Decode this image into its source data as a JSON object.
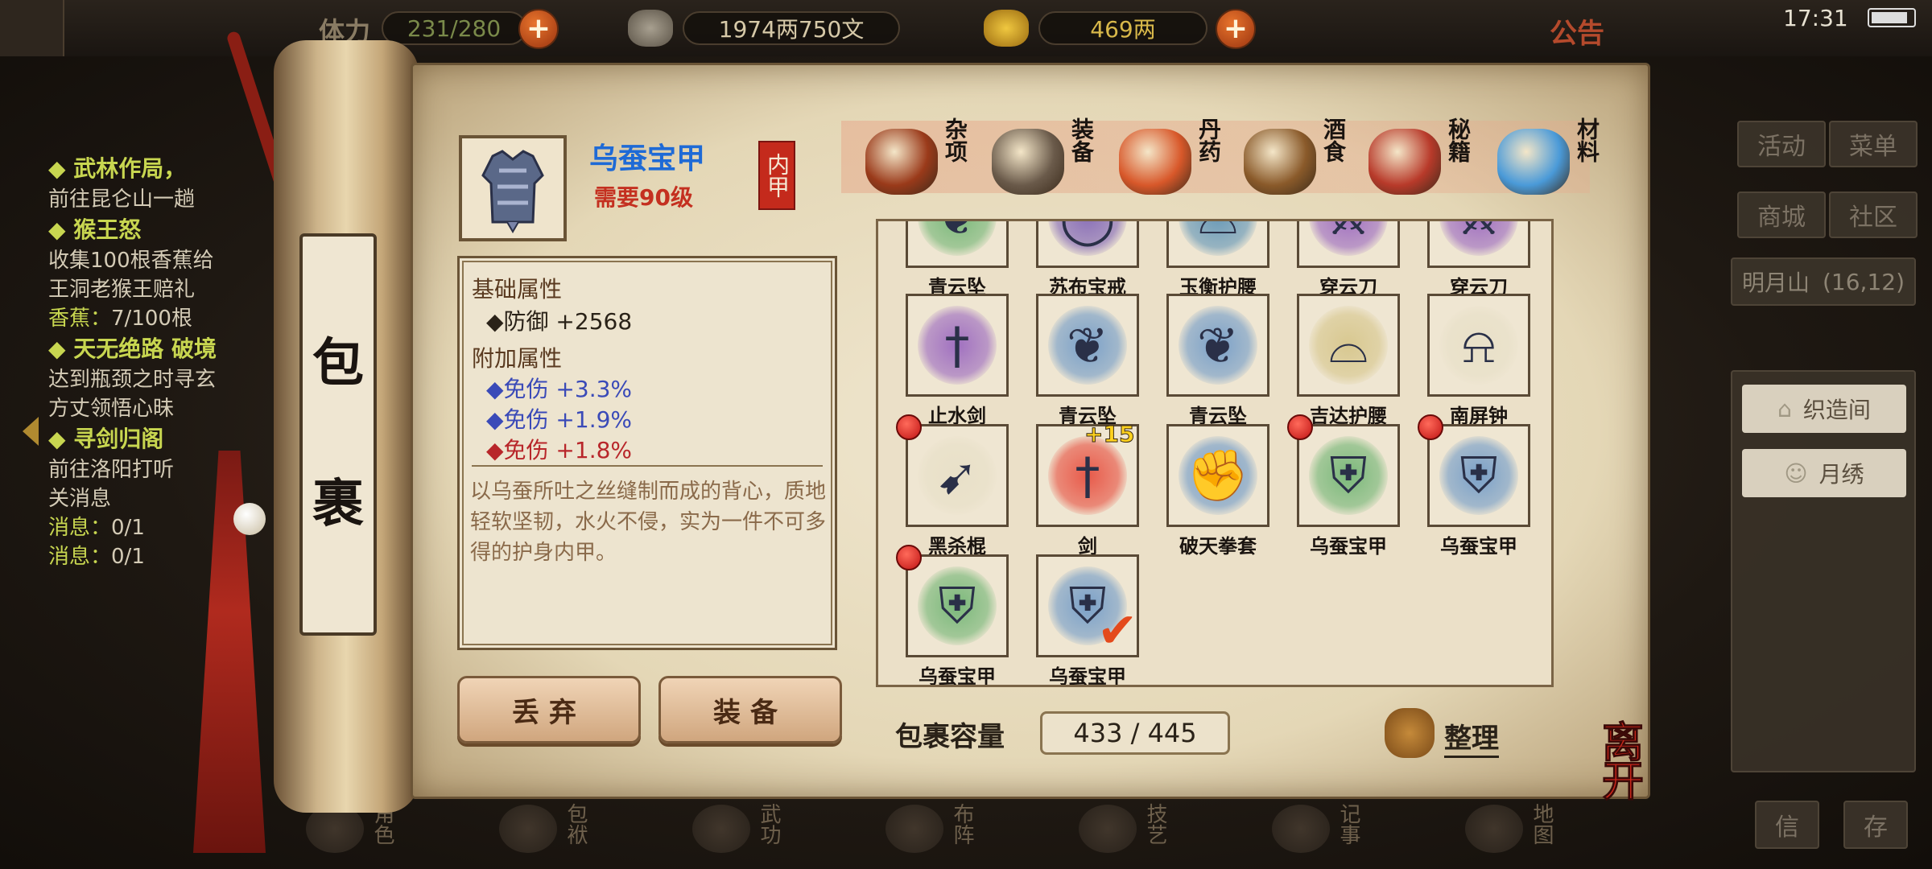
{
  "topbar": {
    "stamina_label": "体力",
    "stamina": "231/280",
    "money": "1974两750文",
    "gold": "469两",
    "notice": "公告",
    "time": "17:31"
  },
  "quests": [
    {
      "title": "◆ 武林作局，",
      "lines": [
        "前往昆仑山一趟"
      ]
    },
    {
      "title": "◆ 猴王怒",
      "lines": [
        "收集100根香蕉给",
        "王洞老猴王赔礼"
      ],
      "progress_label": "香蕉：",
      "progress": "7/100根"
    },
    {
      "title": "◆ 天无绝路 破境",
      "lines": [
        "达到瓶颈之时寻玄",
        "方丈领悟心昧"
      ]
    },
    {
      "title": "◆ 寻剑归阁",
      "lines": [
        "前往洛阳打听",
        "关消息"
      ],
      "progress_label": "消息：",
      "progress": "0/1",
      "progress2_label": "消息：",
      "progress2": "0/1"
    }
  ],
  "right_menu": {
    "buttons": [
      "活动",
      "菜单",
      "商城",
      "社区"
    ],
    "location": "明月山",
    "coords": "(16,12)",
    "side_items": [
      "织造间",
      "月绣"
    ],
    "bottom_buttons": [
      "信",
      "存"
    ]
  },
  "bottom_nav": [
    "角色",
    "包袱",
    "武功",
    "布阵",
    "技艺",
    "记事",
    "地图"
  ],
  "scroll": {
    "char1": "包",
    "char2": "裹"
  },
  "item": {
    "name": "乌蚕宝甲",
    "requirement": "需要90级",
    "type": "内甲",
    "base_title": "基础属性",
    "base_stat": "◆防御 +2568",
    "extra_title": "附加属性",
    "extra_stats": [
      {
        "text": "◆免伤  +3.3%",
        "color": "blue"
      },
      {
        "text": "◆免伤  +1.9%",
        "color": "blue"
      },
      {
        "text": "◆免伤  +1.8%",
        "color": "red"
      }
    ],
    "description": "以乌蚕所吐之丝缝制而成的背心，质地轻软坚韧，水火不侵，实为一件不可多得的护身内甲。"
  },
  "buttons": {
    "discard": "丢弃",
    "equip": "装备"
  },
  "tabs": [
    {
      "label": "杂项",
      "icon": "jar-icon",
      "color": "#9a3a1a"
    },
    {
      "label": "装备",
      "icon": "equipment-icon",
      "color": "#6a5a4a"
    },
    {
      "label": "丹药",
      "icon": "pill-icon",
      "color": "#d8582a"
    },
    {
      "label": "酒食",
      "icon": "wine-food-icon",
      "color": "#8a5a2a"
    },
    {
      "label": "秘籍",
      "icon": "book-icon",
      "color": "#b83a2a"
    },
    {
      "label": "材料",
      "icon": "crystal-icon",
      "color": "#4a9ad8"
    }
  ],
  "grid": {
    "rows": [
      [
        {
          "label": "青云坠",
          "icon": "pendant-icon",
          "bg": "#7ab87a"
        },
        {
          "label": "苏布宝戒",
          "icon": "ring-icon",
          "bg": "#8a70b8"
        },
        {
          "label": "玉衡护腰",
          "icon": "belt-icon",
          "bg": "#6a9ab8"
        },
        {
          "label": "穿云刀",
          "icon": "blade-icon",
          "bg": "#a070c0"
        },
        {
          "label": "穿云刀",
          "icon": "blade-icon",
          "bg": "#a070c0"
        }
      ],
      [
        {
          "label": "止水剑",
          "icon": "sword-icon",
          "bg": "#a070c0"
        },
        {
          "label": "青云坠",
          "icon": "pendant-icon",
          "bg": "#7aa0c8"
        },
        {
          "label": "青云坠",
          "icon": "pendant-icon",
          "bg": "#7aa0c8"
        },
        {
          "label": "吉达护腰",
          "icon": "belt-icon",
          "bg": "#d8c890"
        },
        {
          "label": "南屏钟",
          "icon": "bell-icon",
          "bg": "#e8e0c8"
        }
      ],
      [
        {
          "label": "黑杀棍",
          "icon": "spear-icon",
          "bg": "#e8e0c8",
          "dot": true
        },
        {
          "label": "剑",
          "icon": "sword-icon",
          "bg": "#e85a4a",
          "plus": "+15"
        },
        {
          "label": "破天拳套",
          "icon": "gauntlet-icon",
          "bg": "#7aa0c8"
        },
        {
          "label": "乌蚕宝甲",
          "icon": "armor-icon",
          "bg": "#7ab87a",
          "dot": true
        },
        {
          "label": "乌蚕宝甲",
          "icon": "armor-icon",
          "bg": "#7aa0c8",
          "dot": true
        }
      ],
      [
        {
          "label": "乌蚕宝甲",
          "icon": "armor-icon",
          "bg": "#7ab87a",
          "dot": true
        },
        {
          "label": "乌蚕宝甲",
          "icon": "armor-icon",
          "bg": "#7aa0c8",
          "check": true
        }
      ]
    ]
  },
  "capacity": {
    "label": "包裹容量",
    "value": "433 / 445"
  },
  "sort_label": "整理",
  "leave_label": "离开"
}
